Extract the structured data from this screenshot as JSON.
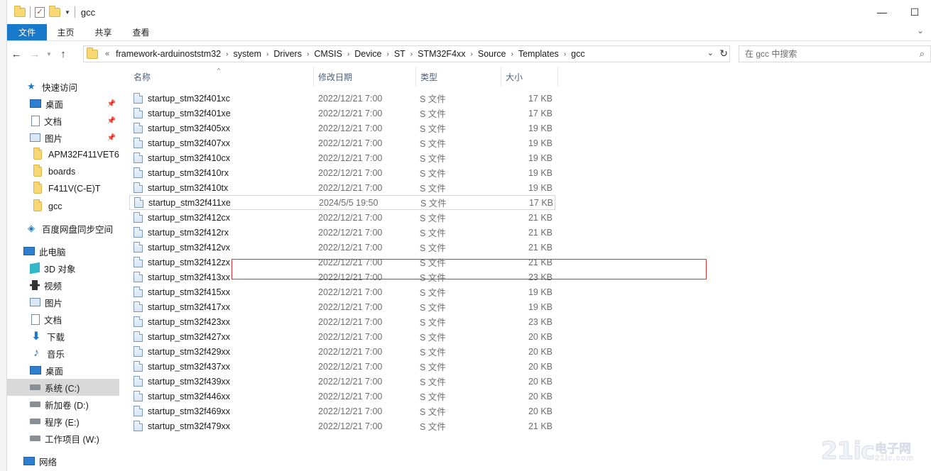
{
  "window": {
    "title": "gcc",
    "controls": {
      "minimize": "—",
      "maximize": "☐"
    }
  },
  "ribbon": {
    "tabs": [
      {
        "label": "文件",
        "active": true
      },
      {
        "label": "主页"
      },
      {
        "label": "共享"
      },
      {
        "label": "查看"
      }
    ],
    "accent": "#1979ca"
  },
  "address": {
    "crumbs": [
      "framework-arduinoststm32",
      "system",
      "Drivers",
      "CMSIS",
      "Device",
      "ST",
      "STM32F4xx",
      "Source",
      "Templates",
      "gcc"
    ],
    "overflow": "«"
  },
  "search": {
    "placeholder": "在 gcc 中搜索"
  },
  "nav": {
    "items": [
      {
        "label": "快速访问",
        "icon": "star-icon",
        "pinned": false
      },
      {
        "label": "桌面",
        "icon": "desktop-icon",
        "pinned": true
      },
      {
        "label": "文档",
        "icon": "document-icon",
        "pinned": true
      },
      {
        "label": "图片",
        "icon": "picture-icon",
        "pinned": true
      },
      {
        "label": "APM32F411VET6",
        "icon": "folder-icon",
        "pinned": false
      },
      {
        "label": "boards",
        "icon": "folder-icon",
        "pinned": false
      },
      {
        "label": "F411V(C-E)T",
        "icon": "folder-icon",
        "pinned": false
      },
      {
        "label": "gcc",
        "icon": "folder-icon",
        "pinned": false
      },
      {
        "label": "百度网盘同步空间",
        "icon": "cloud-sync-icon",
        "pinned": false
      },
      {
        "label": "此电脑",
        "icon": "computer-icon",
        "pinned": false
      },
      {
        "label": "3D 对象",
        "icon": "cube-icon",
        "pinned": false
      },
      {
        "label": "视频",
        "icon": "video-icon",
        "pinned": false
      },
      {
        "label": "图片",
        "icon": "picture-icon",
        "pinned": false
      },
      {
        "label": "文档",
        "icon": "document-icon",
        "pinned": false
      },
      {
        "label": "下载",
        "icon": "download-icon",
        "pinned": false
      },
      {
        "label": "音乐",
        "icon": "music-icon",
        "pinned": false
      },
      {
        "label": "桌面",
        "icon": "desktop-icon",
        "pinned": false
      },
      {
        "label": "系统 (C:)",
        "icon": "system-drive-icon",
        "pinned": false,
        "selected": true
      },
      {
        "label": "新加卷 (D:)",
        "icon": "drive-icon",
        "pinned": false
      },
      {
        "label": "程序 (E:)",
        "icon": "drive-icon",
        "pinned": false
      },
      {
        "label": "工作项目 (W:)",
        "icon": "drive-icon",
        "pinned": false
      },
      {
        "label": "网络",
        "icon": "network-icon",
        "pinned": false
      }
    ]
  },
  "columns": {
    "name": "名称",
    "date": "修改日期",
    "type": "类型",
    "size": "大小"
  },
  "files": [
    {
      "name": "startup_stm32f401xc",
      "date": "2022/12/21 7:00",
      "type": "S 文件",
      "size": "17 KB"
    },
    {
      "name": "startup_stm32f401xe",
      "date": "2022/12/21 7:00",
      "type": "S 文件",
      "size": "17 KB"
    },
    {
      "name": "startup_stm32f405xx",
      "date": "2022/12/21 7:00",
      "type": "S 文件",
      "size": "19 KB"
    },
    {
      "name": "startup_stm32f407xx",
      "date": "2022/12/21 7:00",
      "type": "S 文件",
      "size": "19 KB"
    },
    {
      "name": "startup_stm32f410cx",
      "date": "2022/12/21 7:00",
      "type": "S 文件",
      "size": "19 KB"
    },
    {
      "name": "startup_stm32f410rx",
      "date": "2022/12/21 7:00",
      "type": "S 文件",
      "size": "19 KB"
    },
    {
      "name": "startup_stm32f410tx",
      "date": "2022/12/21 7:00",
      "type": "S 文件",
      "size": "19 KB"
    },
    {
      "name": "startup_stm32f411xe",
      "date": "2024/5/5 19:50",
      "type": "S 文件",
      "size": "17 KB",
      "highlighted": true
    },
    {
      "name": "startup_stm32f412cx",
      "date": "2022/12/21 7:00",
      "type": "S 文件",
      "size": "21 KB"
    },
    {
      "name": "startup_stm32f412rx",
      "date": "2022/12/21 7:00",
      "type": "S 文件",
      "size": "21 KB"
    },
    {
      "name": "startup_stm32f412vx",
      "date": "2022/12/21 7:00",
      "type": "S 文件",
      "size": "21 KB"
    },
    {
      "name": "startup_stm32f412zx",
      "date": "2022/12/21 7:00",
      "type": "S 文件",
      "size": "21 KB"
    },
    {
      "name": "startup_stm32f413xx",
      "date": "2022/12/21 7:00",
      "type": "S 文件",
      "size": "23 KB"
    },
    {
      "name": "startup_stm32f415xx",
      "date": "2022/12/21 7:00",
      "type": "S 文件",
      "size": "19 KB"
    },
    {
      "name": "startup_stm32f417xx",
      "date": "2022/12/21 7:00",
      "type": "S 文件",
      "size": "19 KB"
    },
    {
      "name": "startup_stm32f423xx",
      "date": "2022/12/21 7:00",
      "type": "S 文件",
      "size": "23 KB"
    },
    {
      "name": "startup_stm32f427xx",
      "date": "2022/12/21 7:00",
      "type": "S 文件",
      "size": "20 KB"
    },
    {
      "name": "startup_stm32f429xx",
      "date": "2022/12/21 7:00",
      "type": "S 文件",
      "size": "20 KB"
    },
    {
      "name": "startup_stm32f437xx",
      "date": "2022/12/21 7:00",
      "type": "S 文件",
      "size": "20 KB"
    },
    {
      "name": "startup_stm32f439xx",
      "date": "2022/12/21 7:00",
      "type": "S 文件",
      "size": "20 KB"
    },
    {
      "name": "startup_stm32f446xx",
      "date": "2022/12/21 7:00",
      "type": "S 文件",
      "size": "20 KB"
    },
    {
      "name": "startup_stm32f469xx",
      "date": "2022/12/21 7:00",
      "type": "S 文件",
      "size": "20 KB"
    },
    {
      "name": "startup_stm32f479xx",
      "date": "2022/12/21 7:00",
      "type": "S 文件",
      "size": "21 KB"
    }
  ],
  "annotation": {
    "color": "#e03030"
  },
  "watermark": {
    "big": "21ic",
    "cn": "电子网",
    "en": "21ic.com"
  }
}
